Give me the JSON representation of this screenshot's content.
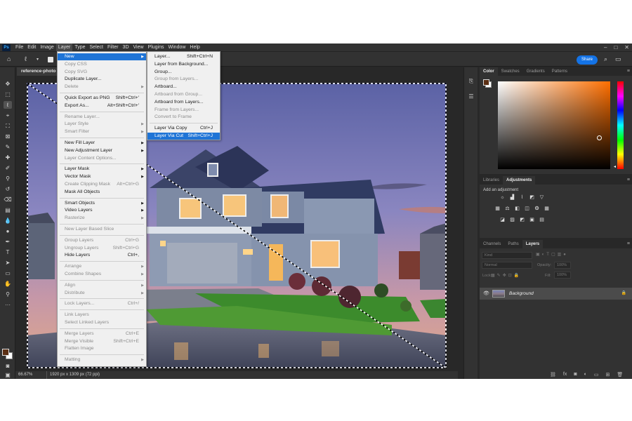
{
  "menubar": {
    "logo": "Ps",
    "items": [
      "File",
      "Edit",
      "Image",
      "Layer",
      "Type",
      "Select",
      "Filter",
      "3D",
      "View",
      "Plugins",
      "Window",
      "Help"
    ],
    "active": "Layer"
  },
  "optionsbar": {
    "share_label": "Share"
  },
  "document": {
    "tab": "reference-photo"
  },
  "status": {
    "zoom": "66.67%",
    "doc_info": "1920 px x 1309 px (72 ppi)"
  },
  "layer_menu": [
    {
      "label": "New",
      "arrow": true,
      "highlight": true
    },
    {
      "label": "Copy CSS",
      "disabled": true
    },
    {
      "label": "Copy SVG",
      "disabled": true
    },
    {
      "label": "Duplicate Layer..."
    },
    {
      "label": "Delete",
      "arrow": true,
      "disabled": true
    },
    {
      "sep": true
    },
    {
      "label": "Quick Export as PNG",
      "shortcut": "Shift+Ctrl+'"
    },
    {
      "label": "Export As...",
      "shortcut": "Alt+Shift+Ctrl+'"
    },
    {
      "sep": true
    },
    {
      "label": "Rename Layer...",
      "disabled": true
    },
    {
      "label": "Layer Style",
      "arrow": true,
      "disabled": true
    },
    {
      "label": "Smart Filter",
      "arrow": true,
      "disabled": true
    },
    {
      "sep": true
    },
    {
      "label": "New Fill Layer",
      "arrow": true
    },
    {
      "label": "New Adjustment Layer",
      "arrow": true
    },
    {
      "label": "Layer Content Options...",
      "disabled": true
    },
    {
      "sep": true
    },
    {
      "label": "Layer Mask",
      "arrow": true
    },
    {
      "label": "Vector Mask",
      "arrow": true
    },
    {
      "label": "Create Clipping Mask",
      "shortcut": "Alt+Ctrl+G",
      "disabled": true
    },
    {
      "label": "Mask All Objects"
    },
    {
      "sep": true
    },
    {
      "label": "Smart Objects",
      "arrow": true
    },
    {
      "label": "Video Layers",
      "arrow": true
    },
    {
      "label": "Rasterize",
      "arrow": true,
      "disabled": true
    },
    {
      "sep": true
    },
    {
      "label": "New Layer Based Slice",
      "disabled": true
    },
    {
      "sep": true
    },
    {
      "label": "Group Layers",
      "shortcut": "Ctrl+G",
      "disabled": true
    },
    {
      "label": "Ungroup Layers",
      "shortcut": "Shift+Ctrl+G",
      "disabled": true
    },
    {
      "label": "Hide Layers",
      "shortcut": "Ctrl+,"
    },
    {
      "sep": true
    },
    {
      "label": "Arrange",
      "arrow": true,
      "disabled": true
    },
    {
      "label": "Combine Shapes",
      "arrow": true,
      "disabled": true
    },
    {
      "sep": true
    },
    {
      "label": "Align",
      "arrow": true,
      "disabled": true
    },
    {
      "label": "Distribute",
      "arrow": true,
      "disabled": true
    },
    {
      "sep": true
    },
    {
      "label": "Lock Layers...",
      "shortcut": "Ctrl+/",
      "disabled": true
    },
    {
      "sep": true
    },
    {
      "label": "Link Layers",
      "disabled": true
    },
    {
      "label": "Select Linked Layers",
      "disabled": true
    },
    {
      "sep": true
    },
    {
      "label": "Merge Layers",
      "shortcut": "Ctrl+E",
      "disabled": true
    },
    {
      "label": "Merge Visible",
      "shortcut": "Shift+Ctrl+E",
      "disabled": true
    },
    {
      "label": "Flatten Image",
      "disabled": true
    },
    {
      "sep": true
    },
    {
      "label": "Matting",
      "arrow": true,
      "disabled": true
    }
  ],
  "new_submenu": [
    {
      "label": "Layer...",
      "shortcut": "Shift+Ctrl+N"
    },
    {
      "label": "Layer from Background..."
    },
    {
      "label": "Group..."
    },
    {
      "label": "Group from Layers...",
      "disabled": true
    },
    {
      "label": "Artboard..."
    },
    {
      "label": "Artboard from Group...",
      "disabled": true
    },
    {
      "label": "Artboard from Layers..."
    },
    {
      "label": "Frame from Layers...",
      "disabled": true
    },
    {
      "label": "Convert to Frame",
      "disabled": true
    },
    {
      "sep": true
    },
    {
      "label": "Layer Via Copy",
      "shortcut": "Ctrl+J"
    },
    {
      "label": "Layer Via Cut",
      "shortcut": "Shift+Ctrl+J",
      "highlight": true
    }
  ],
  "color_panel": {
    "tabs": [
      "Color",
      "Swatches",
      "Gradients",
      "Patterns"
    ],
    "foreground": "#5b2f14"
  },
  "adjust_panel": {
    "tabs": [
      "Libraries",
      "Adjustments"
    ],
    "label": "Add an adjustment"
  },
  "layers_panel": {
    "tabs": [
      "Channels",
      "Paths",
      "Layers"
    ],
    "kind_placeholder": "Kind",
    "blend_mode": "Normal",
    "opacity_label": "Opacity:",
    "opacity": "100%",
    "lock_label": "Lock:",
    "fill_label": "Fill:",
    "fill": "100%",
    "layer_name": "Background"
  }
}
